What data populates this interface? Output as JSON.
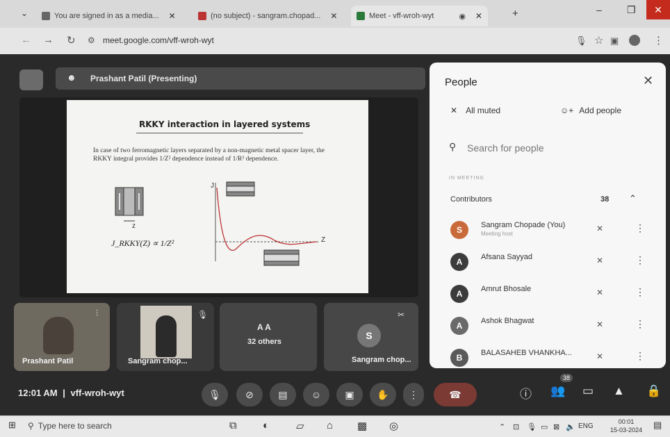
{
  "browser": {
    "tabs": [
      {
        "label": "You are signed in as a media..."
      },
      {
        "label": "(no subject) - sangram.chopad..."
      },
      {
        "label": "Meet - vff-wroh-wyt"
      }
    ],
    "new_tab_label": "+",
    "url": "meet.google.com/vff-wroh-wyt",
    "window_controls": {
      "minimize": "–",
      "maximize": "❐",
      "close": "✕"
    }
  },
  "meet": {
    "presenter_label": "Prashant Patil (Presenting)",
    "slide": {
      "title": "RKKY interaction in layered systems",
      "body": "In case of two ferromagnetic layers separated by a non-magnetic metal spacer layer, the RKKY integral provides 1/Z² dependence instead of 1/R³ dependence.",
      "formula": "J_RKKY(Z) ∝ 1/Z²",
      "axis_j": "J",
      "axis_z": "Z",
      "z_label": "z"
    },
    "tiles": [
      {
        "label": "Prashant Patil"
      },
      {
        "label": "Sangram chop..."
      },
      {
        "label": "32 others",
        "initials": "A A"
      },
      {
        "label": "Sangram chop...",
        "initial": "S"
      }
    ],
    "clock": "12:01 AM",
    "divider": "|",
    "meeting_code": "vff-wroh-wyt",
    "badge_count": "38",
    "controls": [
      "mic",
      "camera",
      "captions",
      "emoji",
      "present",
      "raise-hand",
      "more",
      "leave"
    ],
    "right_controls": [
      "info",
      "people",
      "chat",
      "activities",
      "lock"
    ]
  },
  "people": {
    "title": "People",
    "all_muted": "All muted",
    "add_people": "Add people",
    "search_placeholder": "Search for people",
    "section": "IN MEETING",
    "group": "Contributors",
    "count": "38",
    "list": [
      {
        "name": "Sangram Chopade (You)",
        "sub": "Meeting host",
        "initial": "S",
        "color": "#c96a3b"
      },
      {
        "name": "Afsana Sayyad",
        "sub": "",
        "initial": "A",
        "color": "#3c3c3c"
      },
      {
        "name": "Amrut Bhosale",
        "sub": "",
        "initial": "A",
        "color": "#3c3c3c"
      },
      {
        "name": "Ashok Bhagwat",
        "sub": "",
        "initial": "A",
        "color": "#6a6a6a"
      },
      {
        "name": "BALASAHEB VHANKHA...",
        "sub": "",
        "initial": "B",
        "color": "#5a5a5a"
      }
    ]
  },
  "taskbar": {
    "search_placeholder": "Type here to search",
    "lang": "ENG",
    "time": "00:01",
    "date": "15-03-2024"
  }
}
